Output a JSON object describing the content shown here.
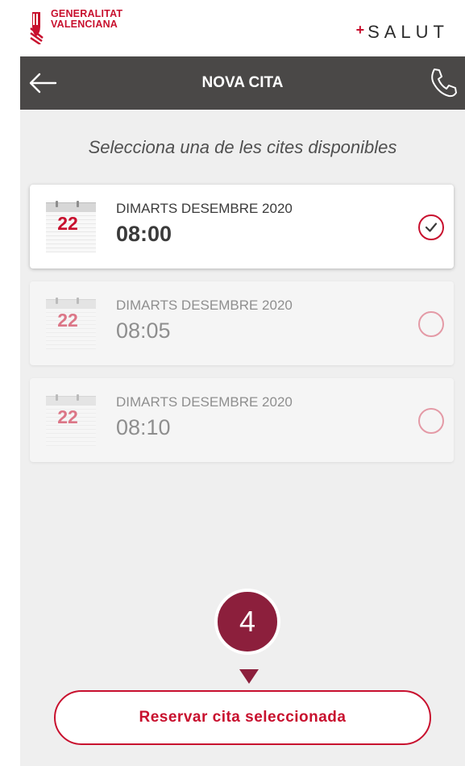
{
  "brand": {
    "gv_line1": "GENERALITAT",
    "gv_line2": "VALENCIANA",
    "salut_plus": "+",
    "salut": "SALUT",
    "accent_color": "#c8102e"
  },
  "header": {
    "title": "NOVA CITA",
    "back_icon": "arrow-left-icon",
    "phone_icon": "phone-icon",
    "bar_color": "#4a4847"
  },
  "subtitle": "Selecciona una de les cites disponibles",
  "appointments": [
    {
      "day": "22",
      "date": "DIMARTS DESEMBRE 2020",
      "time": "08:00",
      "selected": true
    },
    {
      "day": "22",
      "date": "DIMARTS DESEMBRE 2020",
      "time": "08:05",
      "selected": false
    },
    {
      "day": "22",
      "date": "DIMARTS DESEMBRE 2020",
      "time": "08:10",
      "selected": false
    }
  ],
  "step_badge": "4",
  "reserve_button": "Reservar cita seleccionada"
}
